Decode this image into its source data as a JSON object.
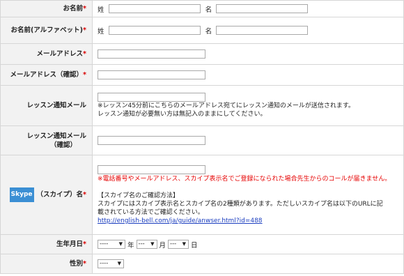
{
  "rows": {
    "name": {
      "label": "お名前",
      "req": "*",
      "sei": "姓",
      "mei": "名"
    },
    "name_alpha": {
      "label": "お名前(アルファベット)",
      "req": "*",
      "sei": "姓",
      "mei": "名"
    },
    "email": {
      "label": "メールアドレス",
      "req": "*"
    },
    "email_confirm": {
      "label": "メールアドレス（確認）",
      "req": "*"
    },
    "notify": {
      "label": "レッスン通知メール",
      "note1": "※レッスン45分前にこちらのメールアドレス宛てにレッスン通知のメールが送信されます。",
      "note2": "レッスン通知が必要無い方は無記入のままにしてください。"
    },
    "notify_confirm": {
      "label1": "レッスン通知メール",
      "label2": "（確認）"
    },
    "skype": {
      "badge": "Skype",
      "label": "（スカイプ）名",
      "req": "*",
      "warn": "※電話番号やメールアドレス、スカイプ表示名でご登録になられた場合先生からのコールが届きません。",
      "info_title": "【スカイプ名のご確認方法】",
      "info1": "スカイプにはスカイプ表示名とスカイプ名の2種類があります。ただしいスカイプ名は以下のURLに記",
      "info2": "載されている方法でご確認ください。",
      "url": "http://english-bell.com/ja/guide/anwser.html?id=488"
    },
    "birthday": {
      "label": "生年月日",
      "req": "*",
      "year_value": "----",
      "year_unit": "年",
      "month_value": "---",
      "month_unit": "月",
      "day_value": "---",
      "day_unit": "日"
    },
    "gender": {
      "label": "性別",
      "req": "*",
      "value": "----"
    }
  }
}
